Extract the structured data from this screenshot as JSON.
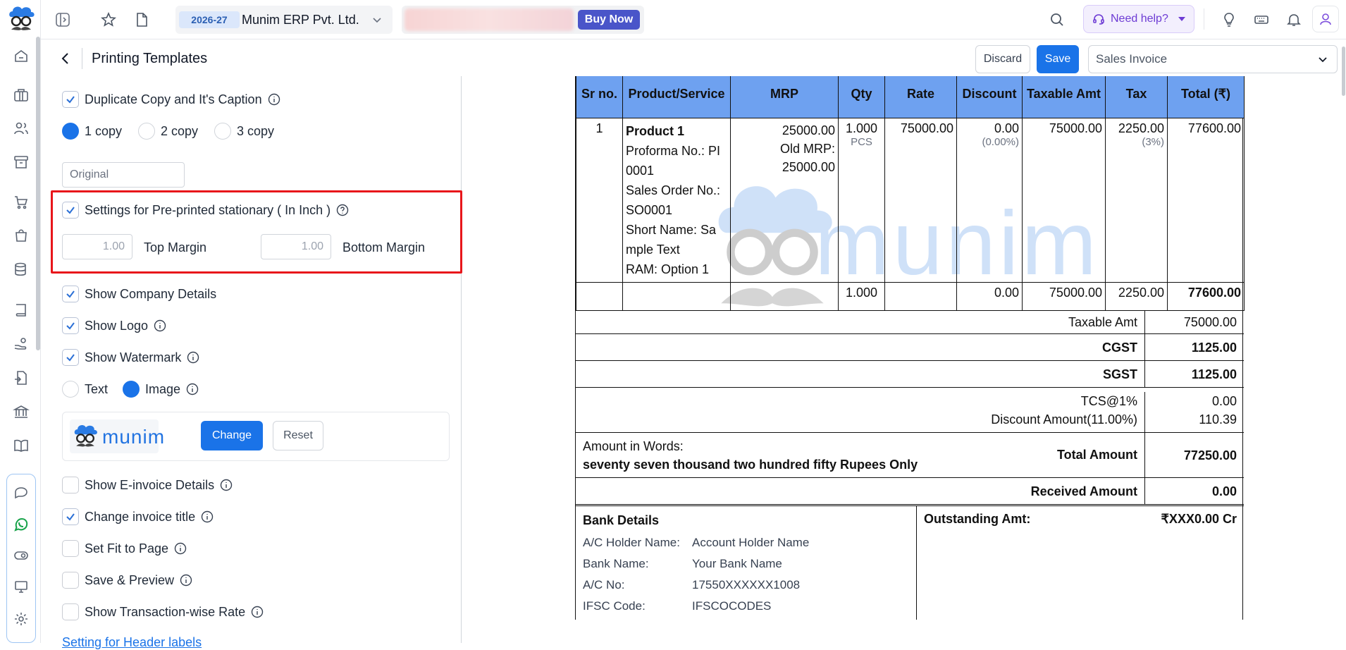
{
  "topbar": {
    "fy_badge": "2026-27",
    "company": "Munim ERP Pvt. Ltd.",
    "buy_now": "Buy Now",
    "need_help": "Need help?"
  },
  "header": {
    "title": "Printing Templates",
    "discard": "Discard",
    "save": "Save",
    "template_select": "Sales Invoice"
  },
  "settings": {
    "duplicate_copy": "Duplicate Copy and It's Caption",
    "copies": [
      "1 copy",
      "2 copy",
      "3 copy"
    ],
    "selected_copy": "1 copy",
    "caption_placeholder": "Original",
    "preprinted": "Settings for Pre-printed stationary ( In Inch )",
    "top_margin_value": "1.00",
    "top_margin_label": "Top Margin",
    "bottom_margin_value": "1.00",
    "bottom_margin_label": "Bottom Margin",
    "show_company": "Show Company Details",
    "show_logo": "Show Logo",
    "show_watermark": "Show Watermark",
    "wm_text": "Text",
    "wm_image": "Image",
    "wm_logo_text": "munim",
    "change": "Change",
    "reset": "Reset",
    "show_einvoice": "Show E-invoice Details",
    "change_title": "Change invoice title",
    "fit_page": "Set Fit to Page",
    "save_preview": "Save & Preview",
    "txn_rate": "Show Transaction-wise Rate",
    "header_labels_link": "Setting for Header labels"
  },
  "invoice": {
    "headers": [
      "Sr no.",
      "Product/Service",
      "MRP",
      "Qty",
      "Rate",
      "Discount",
      "Taxable Amt",
      "Tax",
      "Total (₹)"
    ],
    "item": {
      "sr": "1",
      "name": "Product 1",
      "l1": "Proforma No.: PI",
      "l2": "0001",
      "l3": "Sales Order No.:",
      "l4": "SO0001",
      "l5": "Short Name: Sa",
      "l6": "mple Text",
      "l7": "RAM: Option 1",
      "mrp": "25000.00",
      "old_mrp_label": "Old MRP:",
      "old_mrp": "25000.00",
      "qty": "1.000",
      "unit": "PCS",
      "rate": "75000.00",
      "discount": "0.00",
      "discount_pct": "(0.00%)",
      "taxable": "75000.00",
      "tax": "2250.00",
      "tax_pct": "(3%)",
      "total": "77600.00"
    },
    "sum": {
      "qty": "1.000",
      "discount": "0.00",
      "taxable": "75000.00",
      "tax": "2250.00",
      "total": "77600.00"
    },
    "taxable_amt_label": "Taxable Amt",
    "taxable_amt": "75000.00",
    "cgst_label": "CGST",
    "cgst": "1125.00",
    "sgst_label": "SGST",
    "sgst": "1125.00",
    "tcs_label": "TCS@1%",
    "tcs": "0.00",
    "disc_amt_label": "Discount Amount(11.00%)",
    "disc_amt": "110.39",
    "words_label": "Amount in Words:",
    "words": "seventy seven thousand two hundred fifty Rupees Only",
    "total_amount_label": "Total Amount",
    "total_amount": "77250.00",
    "received_label": "Received Amount",
    "received": "0.00",
    "bank_title": "Bank Details",
    "bank": [
      {
        "k": "A/C Holder Name:",
        "v": "Account Holder Name"
      },
      {
        "k": "Bank Name:",
        "v": "Your Bank Name"
      },
      {
        "k": "A/C No:",
        "v": "17550XXXXXX1008"
      },
      {
        "k": "IFSC Code:",
        "v": "IFSCOCODES"
      }
    ],
    "outstanding_label": "Outstanding Amt:",
    "outstanding": "₹XXX0.00 Cr",
    "watermark_text": "munim"
  }
}
